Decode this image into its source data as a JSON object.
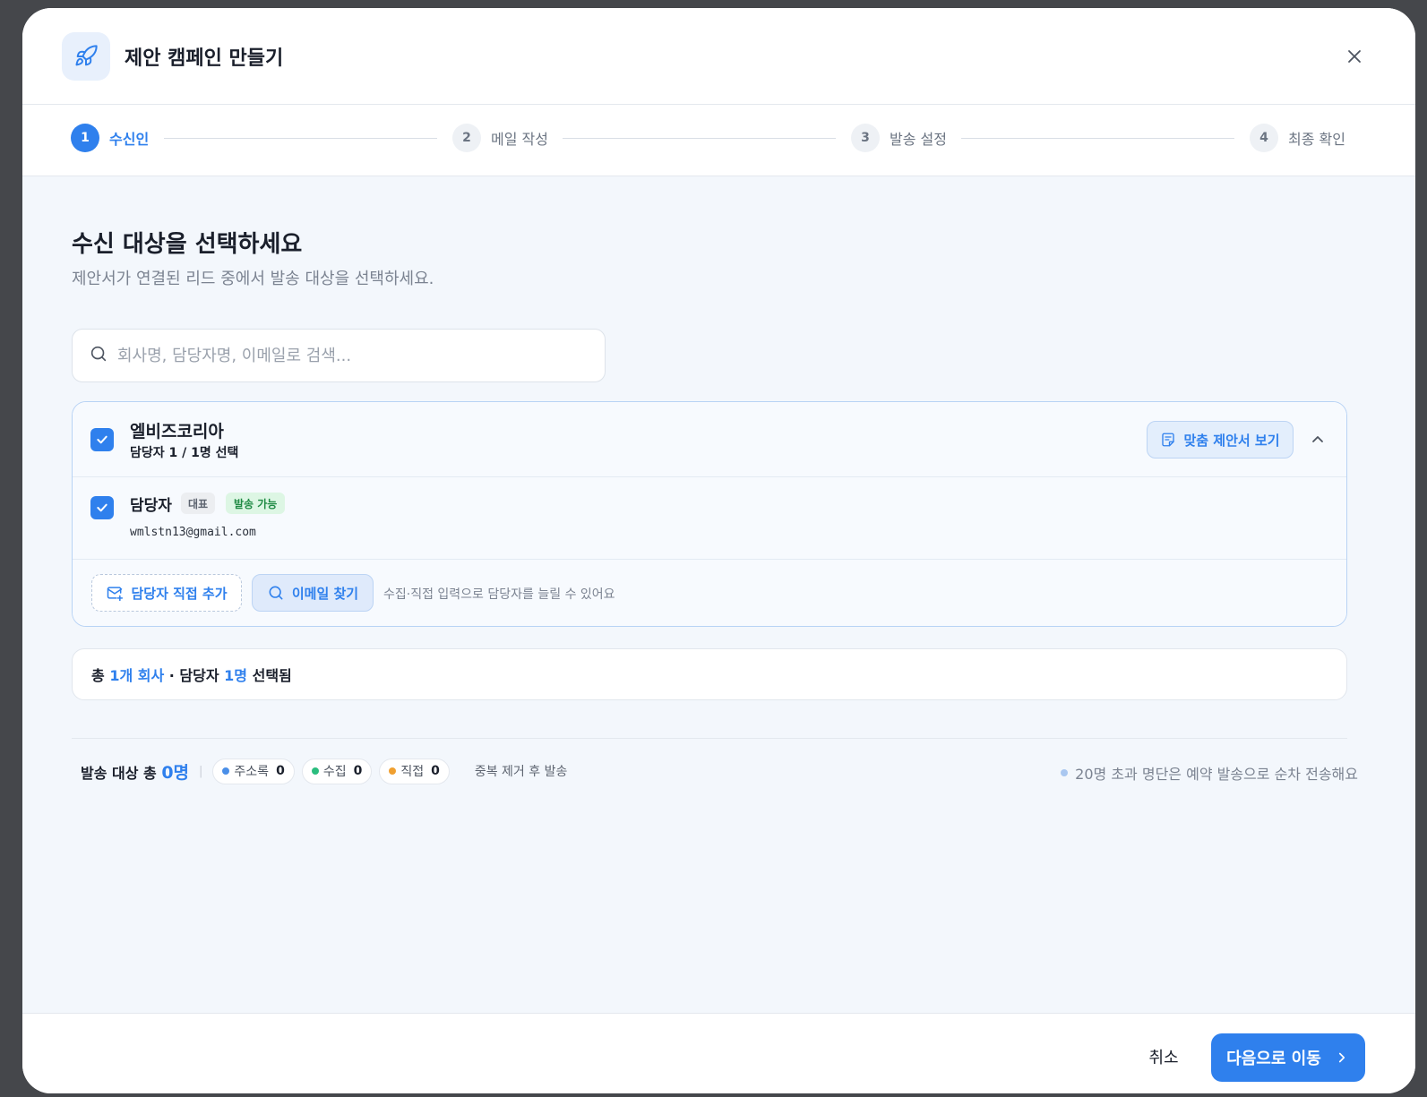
{
  "header": {
    "title": "제안 캠페인 만들기",
    "icon": "rocket-icon",
    "close_icon": "close-icon"
  },
  "stepper": {
    "steps": [
      {
        "num": "1",
        "label": "수신인",
        "active": true
      },
      {
        "num": "2",
        "label": "메일 작성",
        "active": false
      },
      {
        "num": "3",
        "label": "발송 설정",
        "active": false
      },
      {
        "num": "4",
        "label": "최종 확인",
        "active": false
      }
    ]
  },
  "main": {
    "title": "수신 대상을 선택하세요",
    "subtitle": "제안서가 연결된 리드 중에서 발송 대상을 선택하세요.",
    "search": {
      "placeholder": "회사명, 담당자명, 이메일로 검색...",
      "value": ""
    }
  },
  "company": {
    "name": "엘비즈코리아",
    "selected_count": "담당자 1 / 1명 선택",
    "checked": true,
    "proposal_button": "맞춤 제안서 보기",
    "contacts": [
      {
        "name": "담당자",
        "role_badge": "대표",
        "status_badge": "발송 가능",
        "email": "wmlstn13@gmail.com",
        "checked": true
      }
    ],
    "add_contact_button": "담당자 직접 추가",
    "find_email_button": "이메일 찾기",
    "hint": "수집·직접 입력으로 담당자를 늘릴 수 있어요"
  },
  "summary": {
    "prefix": "총",
    "company_count": "1개 회사",
    "middle": "· 담당자",
    "contact_count": "1명",
    "suffix": "선택됨"
  },
  "stats": {
    "label": "발송 대상 총",
    "total": "0명",
    "pills": [
      {
        "label": "주소록",
        "value": "0",
        "color": "#4a8fe8"
      },
      {
        "label": "수집",
        "value": "0",
        "color": "#2bbd7e"
      },
      {
        "label": "직접",
        "value": "0",
        "color": "#f0a030"
      }
    ],
    "dedup": "중복 제거 후 발송",
    "notice": "20명 초과 명단은 예약 발송으로 순차 전송해요"
  },
  "footer": {
    "cancel": "취소",
    "next": "다음으로 이동"
  },
  "colors": {
    "accent": "#2f80ed",
    "success": "#1f8a44",
    "background": "#f3f7fc"
  }
}
